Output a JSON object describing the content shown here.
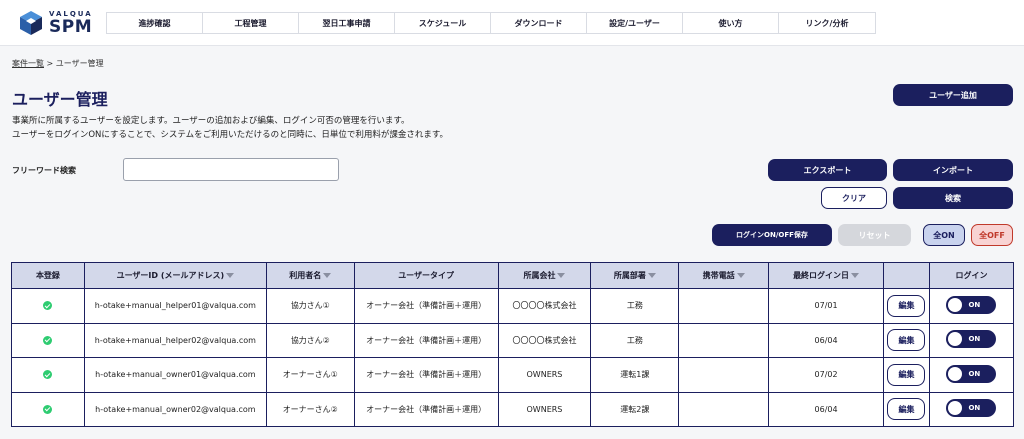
{
  "logo": {
    "small": "VALQUA",
    "big": "SPM"
  },
  "nav": [
    "進捗確認",
    "工程管理",
    "翌日工事申請",
    "スケジュール",
    "ダウンロード",
    "設定/ユーザー",
    "使い方",
    "リンク/分析"
  ],
  "breadcrumb": {
    "link": "案件一覧",
    "sep": " > ",
    "current": "ユーザー管理"
  },
  "page": {
    "title": "ユーザー管理",
    "desc1": "事業所に所属するユーザーを設定します。ユーザーの追加および編集、ログイン可否の管理を行います。",
    "desc2": "ユーザーをログインONにすることで、システムをご利用いただけるのと同時に、日単位で利用料が課金されます。"
  },
  "buttons": {
    "add_user": "ユーザー追加",
    "export": "エクスポート",
    "import": "インポート",
    "clear": "クリア",
    "search": "検索",
    "save_login": "ログインON/OFF保存",
    "reset": "リセット",
    "all_on": "全ON",
    "all_off": "全OFF"
  },
  "search": {
    "label": "フリーワード検索",
    "value": "",
    "placeholder": ""
  },
  "table": {
    "headers": {
      "registered": "本登録",
      "user_id": "ユーザーID (メールアドレス)",
      "user_name": "利用者名",
      "user_type": "ユーザータイプ",
      "company": "所属会社",
      "department": "所属部署",
      "phone": "携帯電話",
      "last_login": "最終ログイン日",
      "edit": "",
      "login": "ログイン"
    },
    "rows": [
      {
        "email": "h-otake+manual_helper01@valqua.com",
        "name": "協力さん①",
        "type": "オーナー会社（準備計画＋運用）",
        "company": "〇〇〇〇株式会社",
        "dept": "工務",
        "phone": "",
        "last_login": "07/01",
        "edit": "編集",
        "toggle": "ON"
      },
      {
        "email": "h-otake+manual_helper02@valqua.com",
        "name": "協力さん②",
        "type": "オーナー会社（準備計画＋運用）",
        "company": "〇〇〇〇株式会社",
        "dept": "工務",
        "phone": "",
        "last_login": "06/04",
        "edit": "編集",
        "toggle": "ON"
      },
      {
        "email": "h-otake+manual_owner01@valqua.com",
        "name": "オーナーさん①",
        "type": "オーナー会社（準備計画＋運用）",
        "company": "OWNERS",
        "dept": "運転1課",
        "phone": "",
        "last_login": "07/02",
        "edit": "編集",
        "toggle": "ON"
      },
      {
        "email": "h-otake+manual_owner02@valqua.com",
        "name": "オーナーさん②",
        "type": "オーナー会社（準備計画＋運用）",
        "company": "OWNERS",
        "dept": "運転2課",
        "phone": "",
        "last_login": "06/04",
        "edit": "編集",
        "toggle": "ON"
      }
    ]
  },
  "colors": {
    "primary": "#1b1f5e",
    "header_bg": "#d3d8ea",
    "alert": "#d0342c",
    "check": "#2ecc71"
  }
}
